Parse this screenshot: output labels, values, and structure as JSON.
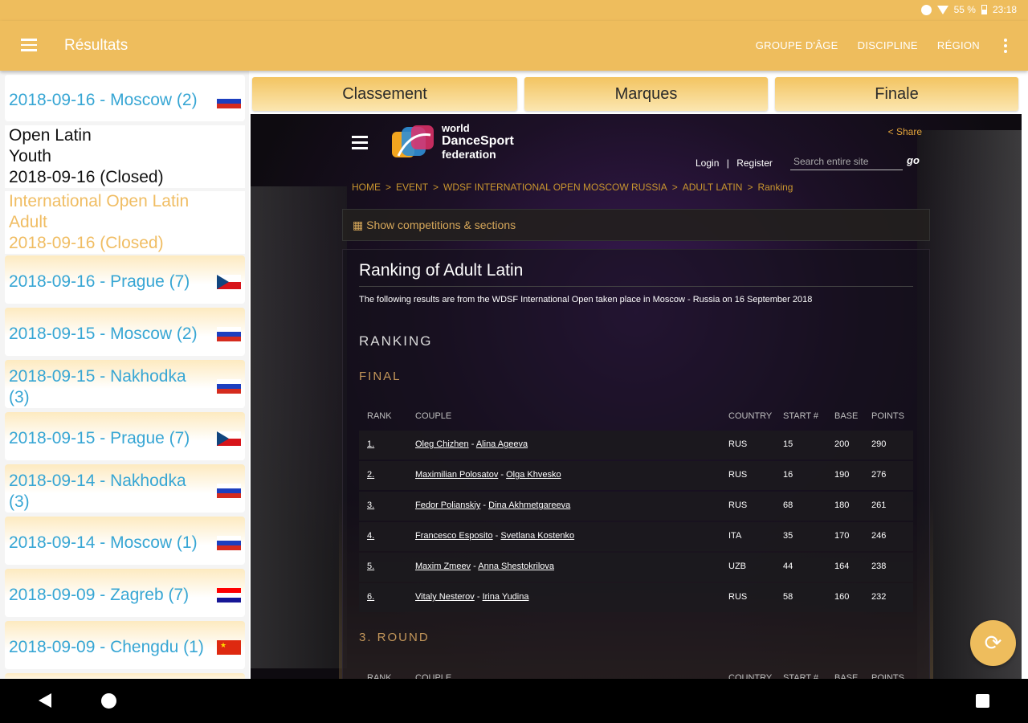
{
  "status": {
    "battery": "55 %",
    "time": "23:18"
  },
  "appbar": {
    "title": "Résultats",
    "actions": [
      "GROUPE D'ÂGE",
      "DISCIPLINE",
      "RÉGION"
    ]
  },
  "left_list": {
    "items": [
      {
        "label": "2018-09-16 - Moscow (2)",
        "flag": "russia"
      },
      {
        "label": "2018-09-16 - Prague (7)",
        "flag": "czech"
      },
      {
        "label": "2018-09-15 - Moscow (2)",
        "flag": "russia"
      },
      {
        "label": "2018-09-15 - Nakhodka",
        "label2": "(3)",
        "flag": "russia"
      },
      {
        "label": "2018-09-15 - Prague (7)",
        "flag": "czech"
      },
      {
        "label": "2018-09-14 - Nakhodka",
        "label2": "(3)",
        "flag": "russia"
      },
      {
        "label": "2018-09-14 - Moscow (1)",
        "flag": "russia"
      },
      {
        "label": "2018-09-09 - Zagreb (7)",
        "flag": "croatia"
      },
      {
        "label": "2018-09-09 - Chengdu (1)",
        "flag": "china"
      }
    ],
    "expanded": [
      {
        "line1": "Open Latin",
        "line2": "Youth",
        "line3": "2018-09-16 (Closed)"
      },
      {
        "line1": "International Open Latin",
        "line2": "Adult",
        "line3": "2018-09-16 (Closed)"
      }
    ]
  },
  "tabs": [
    "Classement",
    "Marques",
    "Finale"
  ],
  "web": {
    "logo_line1": "world",
    "logo_line2": "DanceSport",
    "logo_line3": "federation",
    "share": "Share",
    "login": "Login",
    "sep": "|",
    "register": "Register",
    "search_placeholder": "Search entire site",
    "go": "go",
    "breadcrumb": [
      "HOME",
      "EVENT",
      "WDSF INTERNATIONAL OPEN MOSCOW RUSSIA",
      "ADULT LATIN",
      "Ranking"
    ],
    "crumb_sep": ">",
    "show_sections": "Show competitions & sections",
    "title": "Ranking of Adult Latin",
    "subtitle": "The following results are from the WDSF International Open taken place in Moscow - Russia on 16 September 2018",
    "section_ranking": "RANKING",
    "section_final": "FINAL",
    "section_round": "3. ROUND",
    "columns": {
      "rank": "RANK",
      "couple": "COUPLE",
      "country": "COUNTRY",
      "start": "START #",
      "base": "BASE",
      "points": "POINTS"
    },
    "rows": [
      {
        "rank": "1.",
        "p1": "Oleg Chizhen",
        "p2": "Alina Ageeva",
        "country": "RUS",
        "start": "15",
        "base": "200",
        "points": "290"
      },
      {
        "rank": "2.",
        "p1": "Maximilian Polosatov",
        "p2": "Olga Khvesko",
        "country": "RUS",
        "start": "16",
        "base": "190",
        "points": "276"
      },
      {
        "rank": "3.",
        "p1": "Fedor Polianskiy",
        "p2": "Dina Akhmetgareeva",
        "country": "RUS",
        "start": "68",
        "base": "180",
        "points": "261"
      },
      {
        "rank": "4.",
        "p1": "Francesco Esposito",
        "p2": "Svetlana Kostenko",
        "country": "ITA",
        "start": "35",
        "base": "170",
        "points": "246"
      },
      {
        "rank": "5.",
        "p1": "Maxim Zmeev",
        "p2": "Anna Shestokrilova",
        "country": "UZB",
        "start": "44",
        "base": "164",
        "points": "238"
      },
      {
        "rank": "6.",
        "p1": "Vitaly Nesterov",
        "p2": "Irina Yudina",
        "country": "RUS",
        "start": "58",
        "base": "160",
        "points": "232"
      }
    ],
    "couple_sep": "-"
  },
  "colors": {
    "accent": "#eebd5d",
    "link": "#37a6d4",
    "expanded_text": "#f0bd63",
    "web_gold": "#c4975a"
  },
  "icons": {
    "menu": "hamburger-icon",
    "overflow": "more-vert-icon",
    "fab": "refresh-icon",
    "share": "share-icon"
  }
}
